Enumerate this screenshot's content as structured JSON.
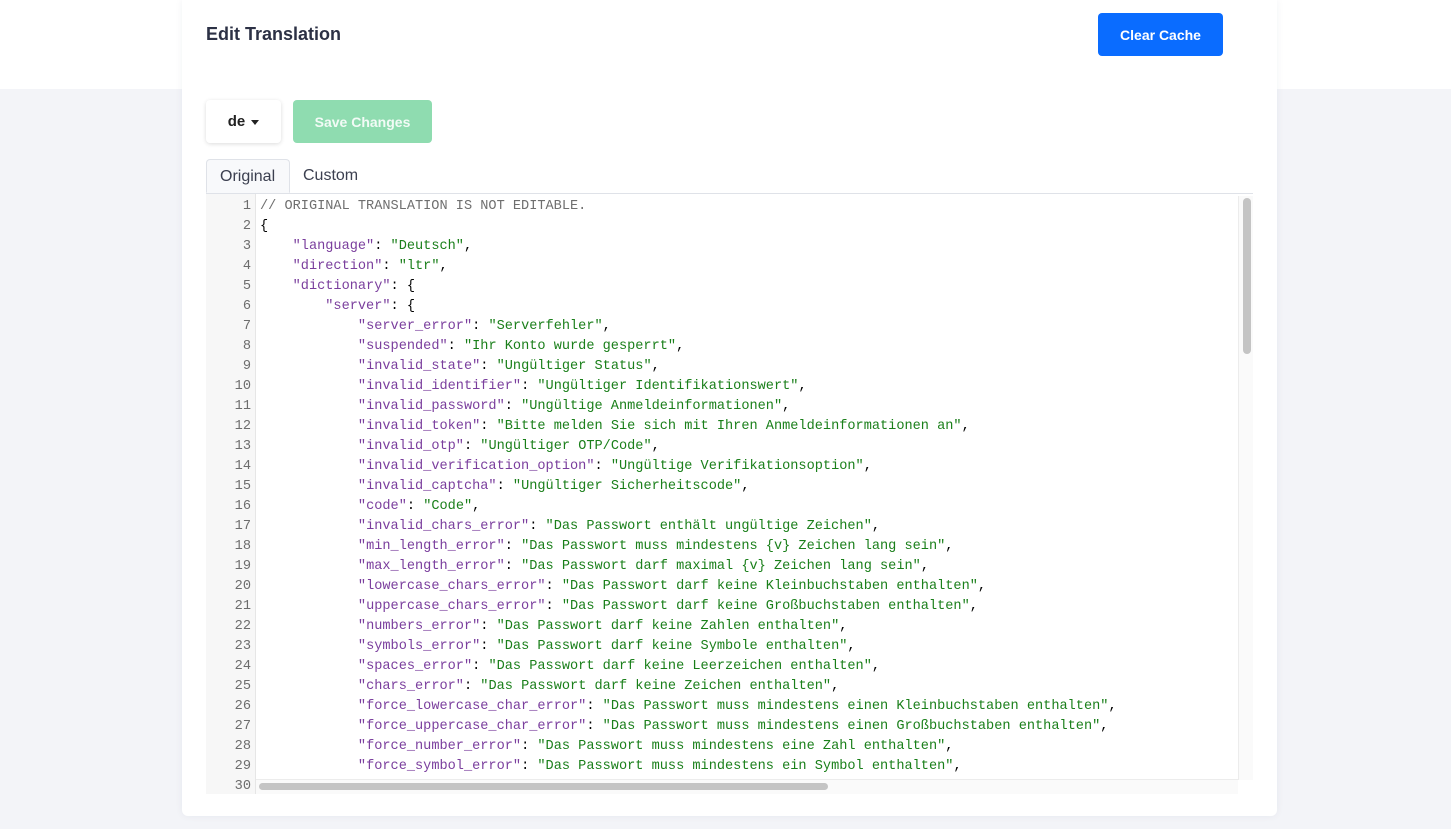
{
  "header": {
    "title": "Edit Translation",
    "clear_cache_label": "Clear Cache"
  },
  "toolbar": {
    "language_selected": "de",
    "save_label": "Save Changes"
  },
  "tabs": {
    "original": "Original",
    "custom": "Custom"
  },
  "editor": {
    "lines": [
      {
        "n": "1",
        "segments": [
          {
            "t": "// ORIGINAL TRANSLATION IS NOT EDITABLE.",
            "c": "comment"
          }
        ]
      },
      {
        "n": "2",
        "segments": [
          {
            "t": "{",
            "c": "punc"
          }
        ]
      },
      {
        "n": "3",
        "segments": [
          {
            "t": "    ",
            "c": "punc"
          },
          {
            "t": "\"language\"",
            "c": "key"
          },
          {
            "t": ": ",
            "c": "punc"
          },
          {
            "t": "\"Deutsch\"",
            "c": "str"
          },
          {
            "t": ",",
            "c": "punc"
          }
        ]
      },
      {
        "n": "4",
        "segments": [
          {
            "t": "    ",
            "c": "punc"
          },
          {
            "t": "\"direction\"",
            "c": "key"
          },
          {
            "t": ": ",
            "c": "punc"
          },
          {
            "t": "\"ltr\"",
            "c": "str"
          },
          {
            "t": ",",
            "c": "punc"
          }
        ]
      },
      {
        "n": "5",
        "segments": [
          {
            "t": "    ",
            "c": "punc"
          },
          {
            "t": "\"dictionary\"",
            "c": "key"
          },
          {
            "t": ": {",
            "c": "punc"
          }
        ]
      },
      {
        "n": "6",
        "segments": [
          {
            "t": "        ",
            "c": "punc"
          },
          {
            "t": "\"server\"",
            "c": "key"
          },
          {
            "t": ": {",
            "c": "punc"
          }
        ]
      },
      {
        "n": "7",
        "segments": [
          {
            "t": "            ",
            "c": "punc"
          },
          {
            "t": "\"server_error\"",
            "c": "key"
          },
          {
            "t": ": ",
            "c": "punc"
          },
          {
            "t": "\"Serverfehler\"",
            "c": "str"
          },
          {
            "t": ",",
            "c": "punc"
          }
        ]
      },
      {
        "n": "8",
        "segments": [
          {
            "t": "            ",
            "c": "punc"
          },
          {
            "t": "\"suspended\"",
            "c": "key"
          },
          {
            "t": ": ",
            "c": "punc"
          },
          {
            "t": "\"Ihr Konto wurde gesperrt\"",
            "c": "str"
          },
          {
            "t": ",",
            "c": "punc"
          }
        ]
      },
      {
        "n": "9",
        "segments": [
          {
            "t": "            ",
            "c": "punc"
          },
          {
            "t": "\"invalid_state\"",
            "c": "key"
          },
          {
            "t": ": ",
            "c": "punc"
          },
          {
            "t": "\"Ungültiger Status\"",
            "c": "str"
          },
          {
            "t": ",",
            "c": "punc"
          }
        ]
      },
      {
        "n": "10",
        "segments": [
          {
            "t": "            ",
            "c": "punc"
          },
          {
            "t": "\"invalid_identifier\"",
            "c": "key"
          },
          {
            "t": ": ",
            "c": "punc"
          },
          {
            "t": "\"Ungültiger Identifikationswert\"",
            "c": "str"
          },
          {
            "t": ",",
            "c": "punc"
          }
        ]
      },
      {
        "n": "11",
        "segments": [
          {
            "t": "            ",
            "c": "punc"
          },
          {
            "t": "\"invalid_password\"",
            "c": "key"
          },
          {
            "t": ": ",
            "c": "punc"
          },
          {
            "t": "\"Ungültige Anmeldeinformationen\"",
            "c": "str"
          },
          {
            "t": ",",
            "c": "punc"
          }
        ]
      },
      {
        "n": "12",
        "segments": [
          {
            "t": "            ",
            "c": "punc"
          },
          {
            "t": "\"invalid_token\"",
            "c": "key"
          },
          {
            "t": ": ",
            "c": "punc"
          },
          {
            "t": "\"Bitte melden Sie sich mit Ihren Anmeldeinformationen an\"",
            "c": "str"
          },
          {
            "t": ",",
            "c": "punc"
          }
        ]
      },
      {
        "n": "13",
        "segments": [
          {
            "t": "            ",
            "c": "punc"
          },
          {
            "t": "\"invalid_otp\"",
            "c": "key"
          },
          {
            "t": ": ",
            "c": "punc"
          },
          {
            "t": "\"Ungültiger OTP/Code\"",
            "c": "str"
          },
          {
            "t": ",",
            "c": "punc"
          }
        ]
      },
      {
        "n": "14",
        "segments": [
          {
            "t": "            ",
            "c": "punc"
          },
          {
            "t": "\"invalid_verification_option\"",
            "c": "key"
          },
          {
            "t": ": ",
            "c": "punc"
          },
          {
            "t": "\"Ungültige Verifikationsoption\"",
            "c": "str"
          },
          {
            "t": ",",
            "c": "punc"
          }
        ]
      },
      {
        "n": "15",
        "segments": [
          {
            "t": "            ",
            "c": "punc"
          },
          {
            "t": "\"invalid_captcha\"",
            "c": "key"
          },
          {
            "t": ": ",
            "c": "punc"
          },
          {
            "t": "\"Ungültiger Sicherheitscode\"",
            "c": "str"
          },
          {
            "t": ",",
            "c": "punc"
          }
        ]
      },
      {
        "n": "16",
        "segments": [
          {
            "t": "            ",
            "c": "punc"
          },
          {
            "t": "\"code\"",
            "c": "key"
          },
          {
            "t": ": ",
            "c": "punc"
          },
          {
            "t": "\"Code\"",
            "c": "str"
          },
          {
            "t": ",",
            "c": "punc"
          }
        ]
      },
      {
        "n": "17",
        "segments": [
          {
            "t": "            ",
            "c": "punc"
          },
          {
            "t": "\"invalid_chars_error\"",
            "c": "key"
          },
          {
            "t": ": ",
            "c": "punc"
          },
          {
            "t": "\"Das Passwort enthält ungültige Zeichen\"",
            "c": "str"
          },
          {
            "t": ",",
            "c": "punc"
          }
        ]
      },
      {
        "n": "18",
        "segments": [
          {
            "t": "            ",
            "c": "punc"
          },
          {
            "t": "\"min_length_error\"",
            "c": "key"
          },
          {
            "t": ": ",
            "c": "punc"
          },
          {
            "t": "\"Das Passwort muss mindestens {v} Zeichen lang sein\"",
            "c": "str"
          },
          {
            "t": ",",
            "c": "punc"
          }
        ]
      },
      {
        "n": "19",
        "segments": [
          {
            "t": "            ",
            "c": "punc"
          },
          {
            "t": "\"max_length_error\"",
            "c": "key"
          },
          {
            "t": ": ",
            "c": "punc"
          },
          {
            "t": "\"Das Passwort darf maximal {v} Zeichen lang sein\"",
            "c": "str"
          },
          {
            "t": ",",
            "c": "punc"
          }
        ]
      },
      {
        "n": "20",
        "segments": [
          {
            "t": "            ",
            "c": "punc"
          },
          {
            "t": "\"lowercase_chars_error\"",
            "c": "key"
          },
          {
            "t": ": ",
            "c": "punc"
          },
          {
            "t": "\"Das Passwort darf keine Kleinbuchstaben enthalten\"",
            "c": "str"
          },
          {
            "t": ",",
            "c": "punc"
          }
        ]
      },
      {
        "n": "21",
        "segments": [
          {
            "t": "            ",
            "c": "punc"
          },
          {
            "t": "\"uppercase_chars_error\"",
            "c": "key"
          },
          {
            "t": ": ",
            "c": "punc"
          },
          {
            "t": "\"Das Passwort darf keine Großbuchstaben enthalten\"",
            "c": "str"
          },
          {
            "t": ",",
            "c": "punc"
          }
        ]
      },
      {
        "n": "22",
        "segments": [
          {
            "t": "            ",
            "c": "punc"
          },
          {
            "t": "\"numbers_error\"",
            "c": "key"
          },
          {
            "t": ": ",
            "c": "punc"
          },
          {
            "t": "\"Das Passwort darf keine Zahlen enthalten\"",
            "c": "str"
          },
          {
            "t": ",",
            "c": "punc"
          }
        ]
      },
      {
        "n": "23",
        "segments": [
          {
            "t": "            ",
            "c": "punc"
          },
          {
            "t": "\"symbols_error\"",
            "c": "key"
          },
          {
            "t": ": ",
            "c": "punc"
          },
          {
            "t": "\"Das Passwort darf keine Symbole enthalten\"",
            "c": "str"
          },
          {
            "t": ",",
            "c": "punc"
          }
        ]
      },
      {
        "n": "24",
        "segments": [
          {
            "t": "            ",
            "c": "punc"
          },
          {
            "t": "\"spaces_error\"",
            "c": "key"
          },
          {
            "t": ": ",
            "c": "punc"
          },
          {
            "t": "\"Das Passwort darf keine Leerzeichen enthalten\"",
            "c": "str"
          },
          {
            "t": ",",
            "c": "punc"
          }
        ]
      },
      {
        "n": "25",
        "segments": [
          {
            "t": "            ",
            "c": "punc"
          },
          {
            "t": "\"chars_error\"",
            "c": "key"
          },
          {
            "t": ": ",
            "c": "punc"
          },
          {
            "t": "\"Das Passwort darf keine Zeichen enthalten\"",
            "c": "str"
          },
          {
            "t": ",",
            "c": "punc"
          }
        ]
      },
      {
        "n": "26",
        "segments": [
          {
            "t": "            ",
            "c": "punc"
          },
          {
            "t": "\"force_lowercase_char_error\"",
            "c": "key"
          },
          {
            "t": ": ",
            "c": "punc"
          },
          {
            "t": "\"Das Passwort muss mindestens einen Kleinbuchstaben enthalten\"",
            "c": "str"
          },
          {
            "t": ",",
            "c": "punc"
          }
        ]
      },
      {
        "n": "27",
        "segments": [
          {
            "t": "            ",
            "c": "punc"
          },
          {
            "t": "\"force_uppercase_char_error\"",
            "c": "key"
          },
          {
            "t": ": ",
            "c": "punc"
          },
          {
            "t": "\"Das Passwort muss mindestens einen Großbuchstaben enthalten\"",
            "c": "str"
          },
          {
            "t": ",",
            "c": "punc"
          }
        ]
      },
      {
        "n": "28",
        "segments": [
          {
            "t": "            ",
            "c": "punc"
          },
          {
            "t": "\"force_number_error\"",
            "c": "key"
          },
          {
            "t": ": ",
            "c": "punc"
          },
          {
            "t": "\"Das Passwort muss mindestens eine Zahl enthalten\"",
            "c": "str"
          },
          {
            "t": ",",
            "c": "punc"
          }
        ]
      },
      {
        "n": "29",
        "segments": [
          {
            "t": "            ",
            "c": "punc"
          },
          {
            "t": "\"force_symbol_error\"",
            "c": "key"
          },
          {
            "t": ": ",
            "c": "punc"
          },
          {
            "t": "\"Das Passwort muss mindestens ein Symbol enthalten\"",
            "c": "str"
          },
          {
            "t": ",",
            "c": "punc"
          }
        ]
      },
      {
        "n": "30",
        "segments": []
      }
    ]
  },
  "colors": {
    "primary": "#0a6cff",
    "success_disabled": "#8fdcb0",
    "json_key": "#7a3e9d",
    "json_string": "#1a7f1a",
    "comment": "#6f6f6f"
  },
  "icons": {
    "dropdown": "caret-down-icon"
  }
}
